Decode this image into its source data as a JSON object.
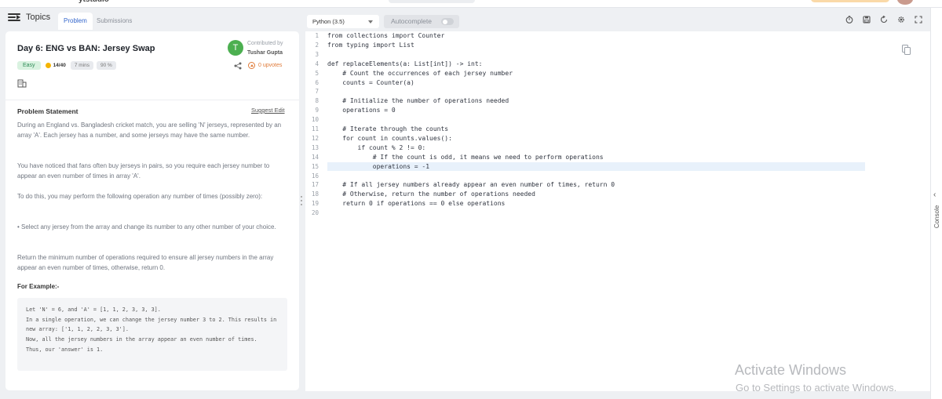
{
  "top": {
    "logo_fragment": "ytstudio"
  },
  "left": {
    "topics_label": "Topics",
    "tabs": [
      "Problem",
      "Submissions"
    ],
    "title": "Day 6: ENG vs BAN: Jersey Swap",
    "contributor": {
      "initial": "T",
      "label": "Contributed by",
      "name": "Tushar Gupta"
    },
    "badges": {
      "difficulty": "Easy",
      "score": "14/40",
      "time": "7 mins",
      "success": "90 %"
    },
    "upvotes": "0 upvotes",
    "statement_heading": "Problem Statement",
    "suggest_edit": "Suggest Edit",
    "paragraphs": [
      "During an England vs. Bangladesh cricket match, you are selling 'N' jerseys, represented by an array 'A'. Each jersey has a number, and some jerseys may have the same number.",
      "You have noticed that fans often buy jerseys in pairs, so you require each jersey number to appear an even number of times in array 'A'.",
      "To do this, you may perform the following operation any number of times (possibly zero):",
      "• Select any jersey from the array and change its number to any other number of your choice.",
      "Return the minimum number of operations required to ensure all jersey numbers in the array appear an even number of times, otherwise, return 0."
    ],
    "example_heading": "For Example:-",
    "example_text": "Let 'N' = 6, and 'A' = [1, 1, 2, 3, 3, 3].\nIn a single operation, we can change the jersey number 3 to 2. This results in new array: ['1, 1, 2, 2, 3, 3'].\nNow, all the jersey numbers in the array appear an even number of times.\nThus, our 'answer' is 1."
  },
  "editor": {
    "language": "Python (3.5)",
    "autocomplete_label": "Autocomplete",
    "lines": [
      {
        "n": "1",
        "t": "from collections import Counter"
      },
      {
        "n": "2",
        "t": "from typing import List"
      },
      {
        "n": "3",
        "t": ""
      },
      {
        "n": "4",
        "t": "def replaceElements(a: List[int]) -> int:"
      },
      {
        "n": "5",
        "t": "    # Count the occurrences of each jersey number"
      },
      {
        "n": "6",
        "t": "    counts = Counter(a)"
      },
      {
        "n": "7",
        "t": ""
      },
      {
        "n": "8",
        "t": "    # Initialize the number of operations needed"
      },
      {
        "n": "9",
        "t": "    operations = 0"
      },
      {
        "n": "10",
        "t": ""
      },
      {
        "n": "11",
        "t": "    # Iterate through the counts"
      },
      {
        "n": "12",
        "t": "    for count in counts.values():"
      },
      {
        "n": "13",
        "t": "        if count % 2 != 0:"
      },
      {
        "n": "14",
        "t": "            # If the count is odd, it means we need to perform operations"
      },
      {
        "n": "15",
        "t": "            operations = -1"
      },
      {
        "n": "16",
        "t": ""
      },
      {
        "n": "17",
        "t": "    # If all jersey numbers already appear an even number of times, return 0"
      },
      {
        "n": "18",
        "t": "    # Otherwise, return the number of operations needed"
      },
      {
        "n": "19",
        "t": "    return 0 if operations == 0 else operations"
      },
      {
        "n": "20",
        "t": ""
      }
    ],
    "highlighted_line": "15"
  },
  "console_label": "Console",
  "watermark": {
    "line1": "Activate Windows",
    "line2": "Go to Settings to activate Windows."
  },
  "colors": {
    "accent": "#3366cc",
    "easy_bg": "#d9f2e0",
    "upvote": "#e07b39",
    "avatar": "#4caf50",
    "highlight": "#e8f1fb"
  }
}
